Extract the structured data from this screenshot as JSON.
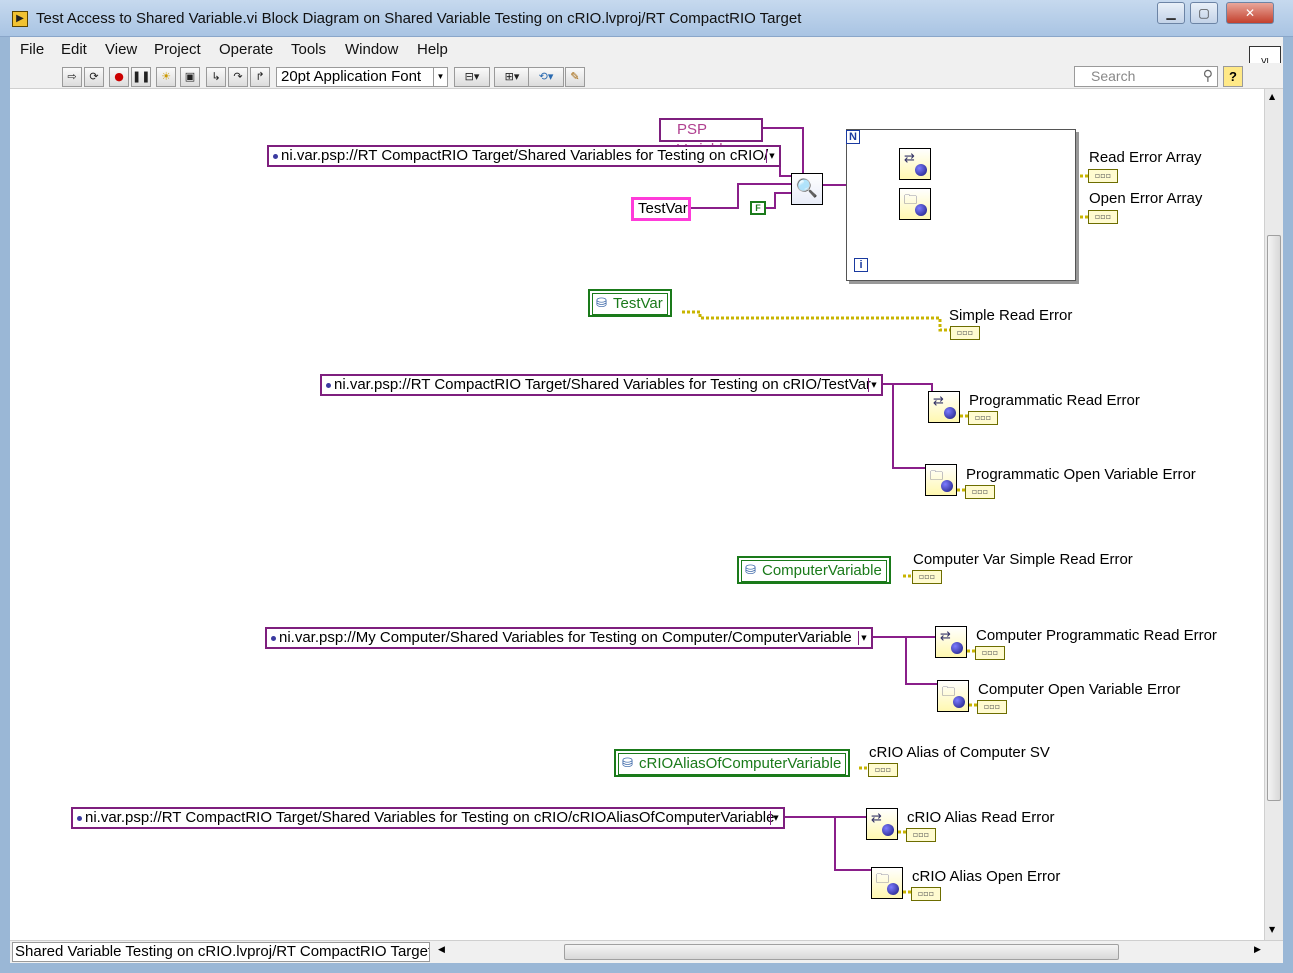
{
  "window": {
    "title": "Test Access to Shared Variable.vi Block Diagram on Shared Variable Testing on cRIO.lvproj/RT CompactRIO Target",
    "minimize": "▁",
    "maximize": "▢",
    "close": "✕"
  },
  "menu": [
    "File",
    "Edit",
    "View",
    "Project",
    "Operate",
    "Tools",
    "Window",
    "Help"
  ],
  "toolbar": {
    "font": "20pt Application Font",
    "search_placeholder": "Search",
    "help": "?"
  },
  "diagram": {
    "psp_variable": "PSP Variable",
    "path_crio_folder": "ni.var.psp://RT CompactRIO Target/Shared Variables for Testing on cRIO/",
    "testvar_string": "TestVar",
    "false_const": "F",
    "loop_n": "N",
    "loop_i": "i",
    "read_error_array": "Read Error Array",
    "open_error_array": "Open Error Array",
    "sv_testvar": "TestVar",
    "simple_read_error": "Simple Read Error",
    "path_crio_testvar": "ni.var.psp://RT CompactRIO Target/Shared Variables for Testing on cRIO/TestVar",
    "programmatic_read_error": "Programmatic Read Error",
    "programmatic_open_error": "Programmatic Open Variable Error",
    "sv_computer": "ComputerVariable",
    "computer_simple_read_error": "Computer Var Simple Read Error",
    "path_computer": "ni.var.psp://My Computer/Shared Variables for Testing on Computer/ComputerVariable",
    "computer_prog_read_error": "Computer Programmatic Read Error",
    "computer_open_error": "Computer Open Variable Error",
    "sv_alias": "cRIOAliasOfComputerVariable",
    "alias_sv_label": "cRIO Alias of Computer SV",
    "path_alias": "ni.var.psp://RT CompactRIO Target/Shared Variables for Testing on cRIO/cRIOAliasOfComputerVariable",
    "alias_read_error": "cRIO Alias Read Error",
    "alias_open_error": "cRIO Alias Open Error"
  },
  "status": {
    "path": "Shared Variable Testing on cRIO.lvproj/RT CompactRIO Target"
  },
  "colors": {
    "wire_refnum": "#8a1f8a",
    "wire_error": "#c8b400",
    "sv_green": "#1a7a1a",
    "string_pink": "#ff3bd9"
  }
}
